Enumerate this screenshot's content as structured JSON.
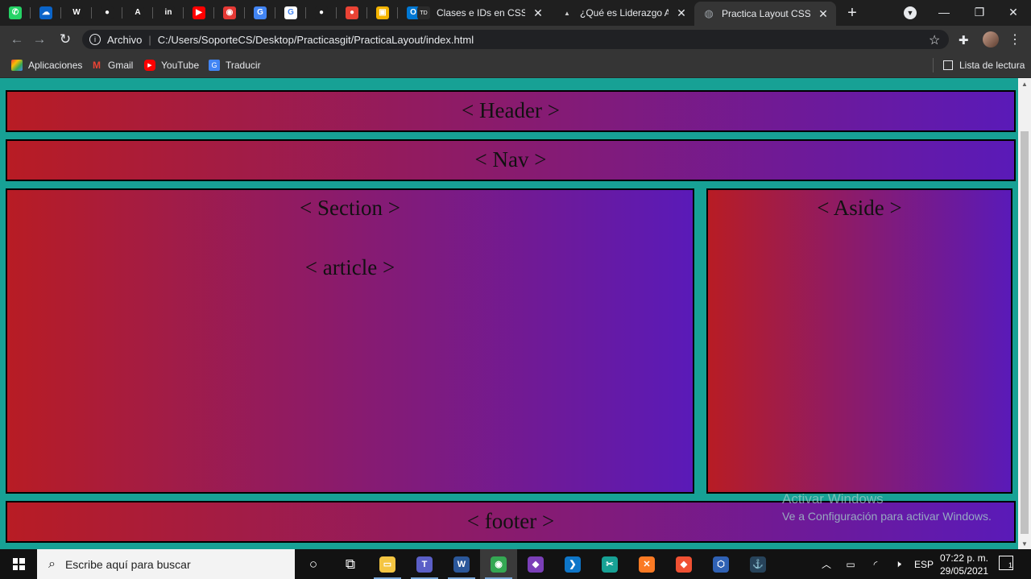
{
  "browser": {
    "pinned_tabs": [
      {
        "icon": "whatsapp-icon",
        "glyph": "✆",
        "color": "#25d366"
      },
      {
        "icon": "onedrive-icon",
        "glyph": "☁",
        "color": "#0a64c9"
      },
      {
        "icon": "wix-icon",
        "glyph": "W",
        "color": "#1f1f1f"
      },
      {
        "icon": "github-icon",
        "glyph": "●",
        "color": "#1f1f1f"
      },
      {
        "icon": "a-icon",
        "glyph": "A",
        "color": "#1f1f1f"
      },
      {
        "icon": "in-icon",
        "glyph": "in",
        "color": "#1f1f1f"
      },
      {
        "icon": "youtube-icon",
        "glyph": "▶",
        "color": "#ff0000"
      },
      {
        "icon": "video-icon",
        "glyph": "◉",
        "color": "#e53935"
      },
      {
        "icon": "translate-icon",
        "glyph": "G",
        "color": "#4285f4"
      },
      {
        "icon": "google-icon",
        "glyph": "G",
        "color": "#ffffff"
      },
      {
        "icon": "github-icon",
        "glyph": "●",
        "color": "#1f1f1f"
      },
      {
        "icon": "record-icon",
        "glyph": "●",
        "color": "#ea4335"
      },
      {
        "icon": "box-icon",
        "glyph": "▣",
        "color": "#f4b400"
      },
      {
        "icon": "outlook-icon",
        "glyph": "O",
        "color": "#0078d4"
      }
    ],
    "tabs": [
      {
        "label": "Clases e IDs en CSS: Cu",
        "icon": "w3-icon",
        "color": "#2b2b2b",
        "glyph": "TD"
      },
      {
        "label": "¿Qué es Liderazgo Auto",
        "icon": "graduation-cap-icon",
        "color": "#2b2b2b",
        "glyph": "▲"
      },
      {
        "label": "Practica Layout CSS",
        "icon": "globe-icon",
        "color": "#777777",
        "glyph": "◍"
      }
    ],
    "address": {
      "scheme": "Archivo",
      "url": "C:/Users/SoporteCS/Desktop/Practicasgit/PracticaLayout/index.html"
    },
    "bookmarks": [
      {
        "label": "Aplicaciones",
        "icon": "apps-grid-icon",
        "color": "#ea4335"
      },
      {
        "label": "Gmail",
        "icon": "gmail-icon",
        "color": "#ea4335"
      },
      {
        "label": "YouTube",
        "icon": "youtube-icon",
        "color": "#ff0000"
      },
      {
        "label": "Traducir",
        "icon": "translate-icon",
        "color": "#4285f4"
      }
    ],
    "reading_list": "Lista de lectura"
  },
  "page": {
    "header": "< Header >",
    "nav": "< Nav >",
    "section": "< Section >",
    "article": "< article >",
    "aside": "< Aside >",
    "footer": "< footer >",
    "background_color": "#17a195",
    "gradient_start": "#b81c24",
    "gradient_end": "#5a1ab8"
  },
  "watermark": {
    "line1": "Activar Windows",
    "line2": "Ve a Configuración para activar Windows."
  },
  "taskbar": {
    "search_placeholder": "Escribe aquí para buscar",
    "apps": [
      {
        "icon": "cortana-icon",
        "glyph": "○",
        "color": "transparent"
      },
      {
        "icon": "task-view-icon",
        "glyph": "⧉",
        "color": "transparent"
      },
      {
        "icon": "file-explorer-icon",
        "glyph": "▭",
        "color": "#f4c542"
      },
      {
        "icon": "teams-icon",
        "glyph": "T",
        "color": "#5b5fc7"
      },
      {
        "icon": "word-icon",
        "glyph": "W",
        "color": "#2b579a"
      },
      {
        "icon": "chrome-icon",
        "glyph": "◉",
        "color": "#34a853"
      },
      {
        "icon": "visual-studio-icon",
        "glyph": "◆",
        "color": "#7b3fb8"
      },
      {
        "icon": "vscode-icon",
        "glyph": "❯",
        "color": "#0e76c8"
      },
      {
        "icon": "snip-icon",
        "glyph": "✂",
        "color": "#17a195"
      },
      {
        "icon": "xampp-icon",
        "glyph": "✕",
        "color": "#fb7a24"
      },
      {
        "icon": "git-icon",
        "glyph": "◆",
        "color": "#f05133"
      },
      {
        "icon": "virtualbox-icon",
        "glyph": "⬡",
        "color": "#2f61b4"
      },
      {
        "icon": "mysql-workbench-icon",
        "glyph": "⚓",
        "color": "#27435a"
      }
    ],
    "language": "ESP",
    "time": "07:22 p. m.",
    "date": "29/05/2021",
    "notifications": "1"
  }
}
